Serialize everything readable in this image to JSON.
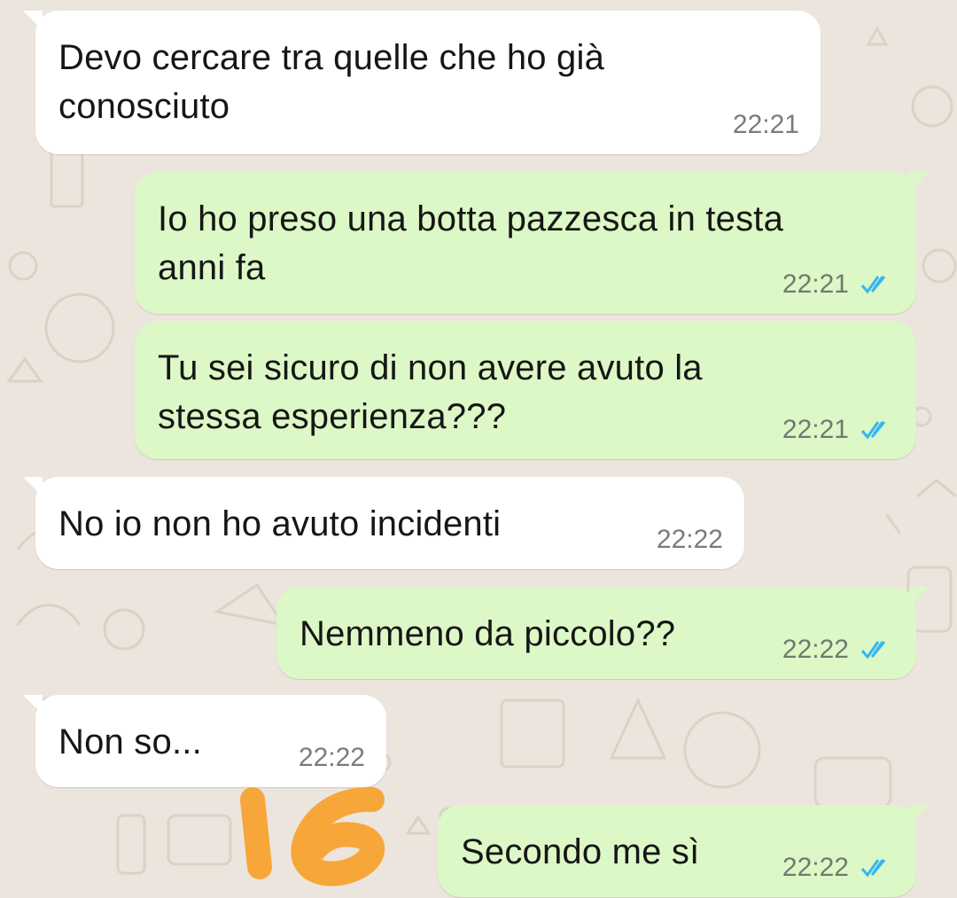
{
  "colors": {
    "incoming_bubble": "#ffffff",
    "outgoing_bubble": "#dcf8c6",
    "read_ticks": "#34b7f1",
    "annotation_orange": "#f7a63a",
    "background": "#ece5dd"
  },
  "messages": [
    {
      "direction": "incoming",
      "text": "Devo cercare tra quelle che ho già\nconosciuto",
      "time": "22:21"
    },
    {
      "direction": "outgoing",
      "text": "Io ho preso una botta pazzesca in testa\nanni fa",
      "time": "22:21",
      "status_icon": "double-check-read-icon"
    },
    {
      "direction": "outgoing",
      "text": "Tu sei sicuro di non avere avuto la\nstessa esperienza???",
      "time": "22:21",
      "status_icon": "double-check-read-icon"
    },
    {
      "direction": "incoming",
      "text": "No io non ho avuto incidenti",
      "time": "22:22"
    },
    {
      "direction": "outgoing",
      "text": "Nemmeno da piccolo??",
      "time": "22:22",
      "status_icon": "double-check-read-icon"
    },
    {
      "direction": "incoming",
      "text": "Non so...",
      "time": "22:22"
    },
    {
      "direction": "outgoing",
      "text": "Secondo me sì",
      "time": "22:22",
      "status_icon": "double-check-read-icon"
    }
  ],
  "annotation": {
    "text": "16"
  }
}
